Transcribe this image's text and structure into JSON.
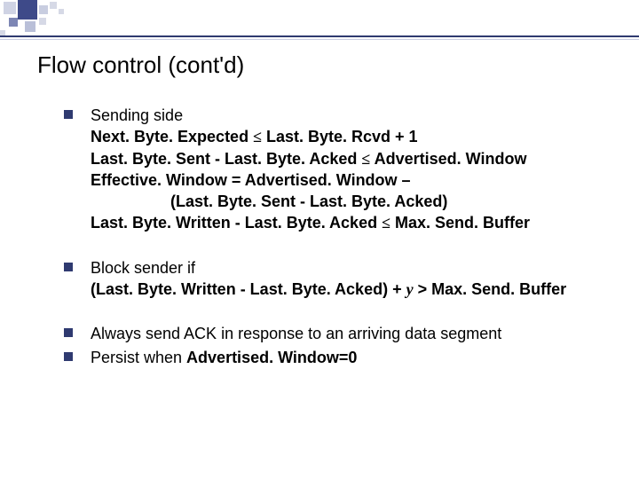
{
  "title": "Flow control (cont'd)",
  "le": "≤",
  "bullets": {
    "b1": {
      "l1": "Sending side",
      "l2a": "Next. Byte. Expected ",
      "l2b": " Last. Byte. Rcvd + 1",
      "l3a": "Last. Byte. Sent - Last. Byte. Acked ",
      "l3b": " Advertised. Window",
      "l4": "Effective. Window = Advertised. Window –",
      "l5": "(Last. Byte. Sent - Last. Byte. Acked)",
      "l6a": "Last. Byte. Written - Last. Byte. Acked ",
      "l6b": " Max. Send. Buffer"
    },
    "b2": {
      "l1": "Block sender if",
      "l2a": "(Last. Byte. Written - Last. Byte. Acked) + ",
      "l2y": "y",
      "l2b": "  > Max. Send. Buffer"
    },
    "b3": {
      "text": "Always send ACK in response to an arriving data segment"
    },
    "b4": {
      "t1": "Persist when ",
      "t2": "Advertised. Window=0"
    }
  }
}
